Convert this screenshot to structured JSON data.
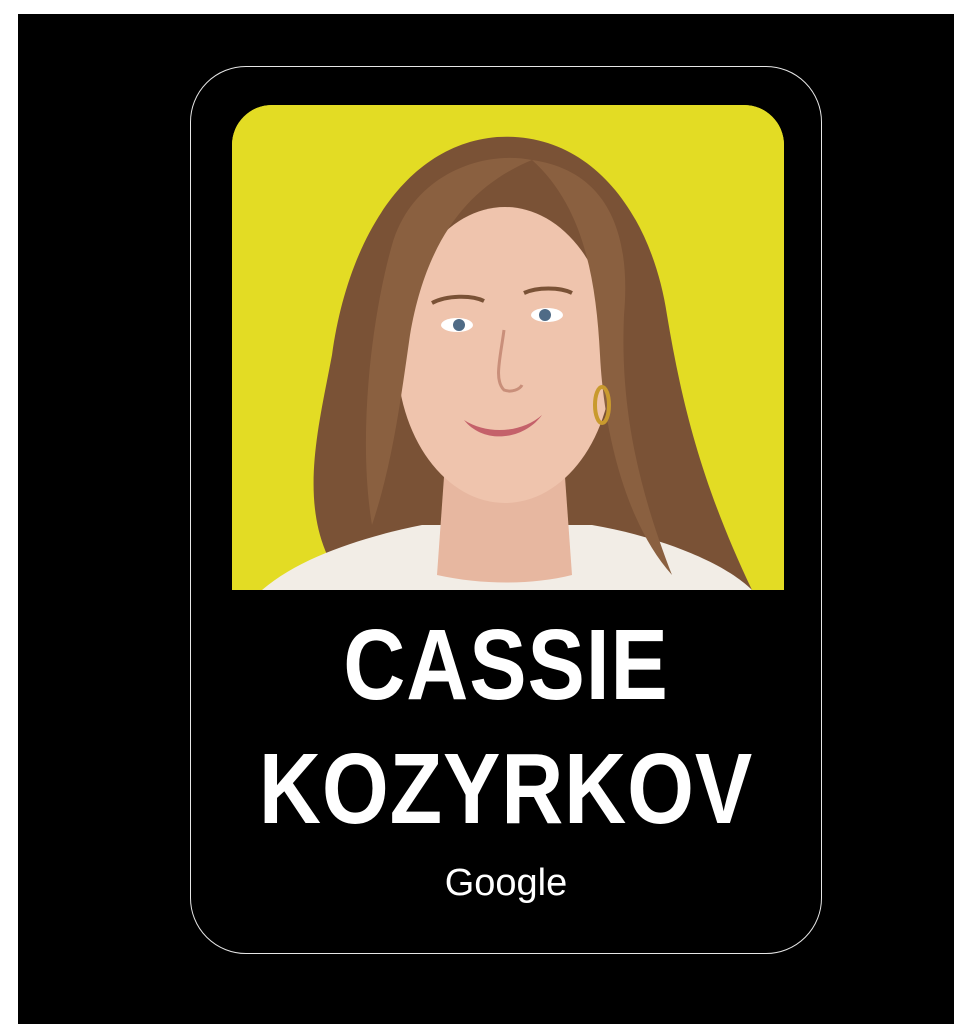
{
  "card": {
    "name_line1": "CASSIE",
    "name_line2": "KOZYRKOV",
    "company": "Google"
  },
  "colors": {
    "background": "#000000",
    "photo_background": "#e3dc24",
    "card_border": "#e6e6e6",
    "text": "#ffffff"
  },
  "icons": [
    "portrait-photo"
  ]
}
